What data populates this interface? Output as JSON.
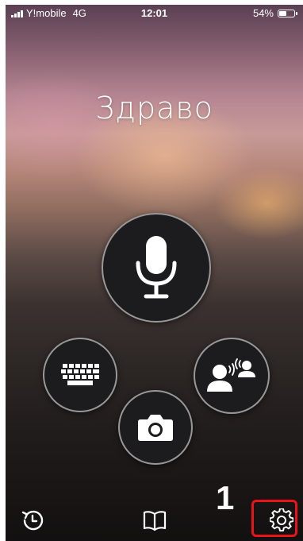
{
  "status_bar": {
    "carrier": "Y!mobile",
    "network": "4G",
    "time": "12:01",
    "battery_percent": "54%",
    "battery_level": 0.54
  },
  "main": {
    "greeting": "Здраво"
  },
  "buttons": {
    "microphone": {
      "icon": "microphone-icon"
    },
    "keyboard": {
      "icon": "keyboard-icon"
    },
    "conversation": {
      "icon": "conversation-icon"
    },
    "camera": {
      "icon": "camera-icon"
    }
  },
  "bottom_nav": {
    "history": {
      "icon": "history-icon"
    },
    "phrasebook": {
      "icon": "book-icon"
    },
    "settings": {
      "icon": "gear-icon"
    }
  },
  "annotation": {
    "step_label": "1",
    "highlight_color": "#e8141a"
  }
}
